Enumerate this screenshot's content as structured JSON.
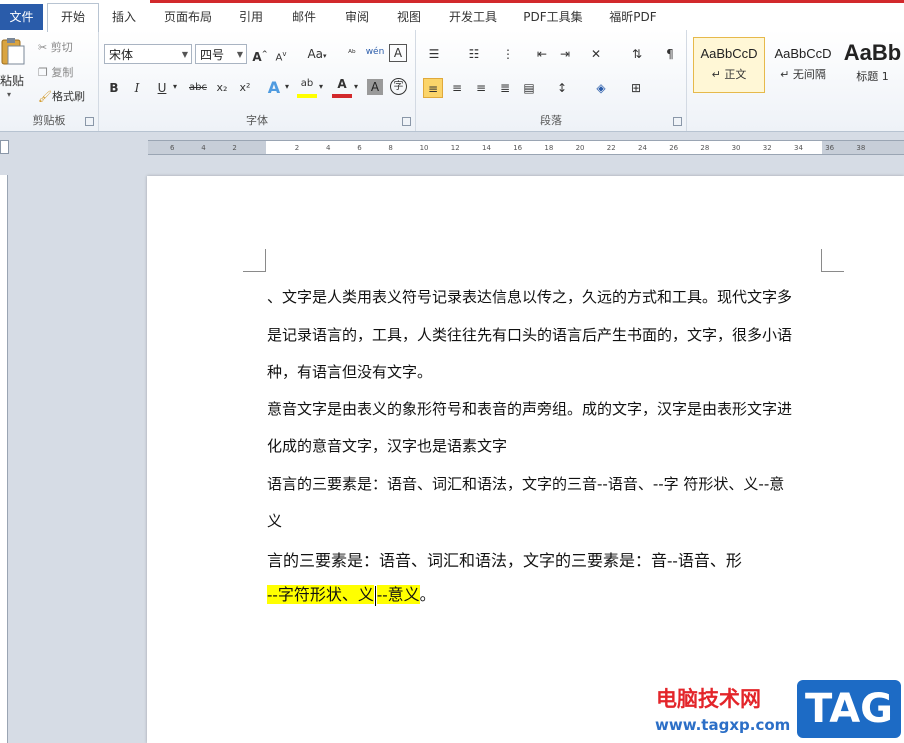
{
  "menubar": {
    "file": "文件",
    "tabs": [
      "开始",
      "插入",
      "页面布局",
      "引用",
      "邮件",
      "审阅",
      "视图",
      "开发工具",
      "PDF工具集",
      "福昕PDF"
    ]
  },
  "clipboard": {
    "paste": "粘贴",
    "cut": "剪切",
    "copy": "复制",
    "format_painter": "格式刷",
    "label": "剪贴板"
  },
  "font": {
    "name": "宋体",
    "size": "四号",
    "grow": "A",
    "shrink": "A",
    "change_case": "Aa",
    "pinyin": "wén",
    "bold": "B",
    "italic": "I",
    "underline": "U",
    "strike": "abc",
    "subscript": "x₂",
    "superscript": "x²",
    "text_effect": "A",
    "highlight": "ab",
    "font_color": "A",
    "char_shading": "A",
    "enclose": "字",
    "border_char": "A",
    "label": "字体"
  },
  "paragraph": {
    "label": "段落"
  },
  "styles": [
    {
      "sample": "AaBbCcD",
      "name": "↵ 正文"
    },
    {
      "sample": "AaBbCcD",
      "name": "↵ 无间隔"
    },
    {
      "sample": "AaBb",
      "name": "标题 1"
    }
  ],
  "ruler": {
    "ticks": [
      "6",
      "4",
      "2",
      "",
      "2",
      "4",
      "6",
      "8",
      "10",
      "12",
      "14",
      "16",
      "18",
      "20",
      "22",
      "24",
      "26",
      "28",
      "30",
      "32",
      "34",
      "36",
      "38"
    ]
  },
  "document": {
    "lines": [
      "、文字是人类用表义符号记录表达信息以传之，久远的方式和工具。现代文字多",
      "是记录语言的，工具，人类往往先有口头的语言后产生书面的，文字，很多小语",
      "种，有语言但没有文字。",
      "意音文字是由表义的象形符号和表音的声旁组。成的文字，汉字是由表形文字进",
      "化成的意音文字，汉字也是语素文字",
      "语言的三要素是：语音、词汇和语法，文字的三音--语音、--字 符形状、义--意",
      "义",
      "言的三要素是：语音、词汇和语法，文字的三要素是：音--语音、形"
    ],
    "highlight_part1": "--字符形状、义",
    "highlight_part2": "--意义",
    "tail": "。"
  },
  "watermark": {
    "title": "电脑技术网",
    "url": "www.tagxp.com",
    "badge": "TAG"
  },
  "colors": {
    "file_tab": "#2a5caa",
    "highlight": "#ffff00",
    "watermark_red": "#e3252a",
    "watermark_blue": "#1d6bc5"
  }
}
